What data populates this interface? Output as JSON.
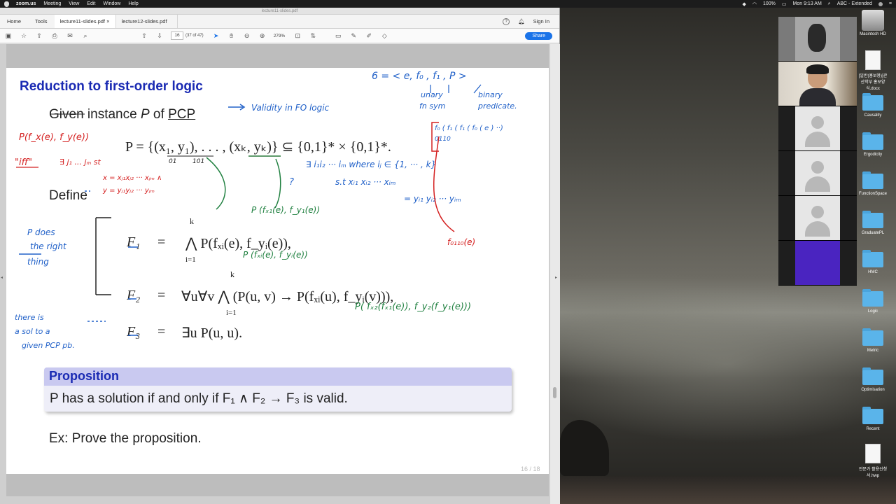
{
  "menubar": {
    "app": "zoom.us",
    "items": [
      "Meeting",
      "View",
      "Edit",
      "Window",
      "Help"
    ],
    "battery": "100%",
    "datetime": "Mon 9:13 AM",
    "input": "ABC - Extended"
  },
  "window": {
    "title": "lecture11-slides.pdf"
  },
  "tabs": {
    "home": "Home",
    "tools": "Tools",
    "tab1": "lecture11-slides.pdf",
    "tab2": "lecture12-slides.pdf",
    "close": "×",
    "help": "?",
    "signin": "Sign In"
  },
  "toolbar": {
    "page_current": "16",
    "page_of": "(37 of 47)",
    "zoom": "279%",
    "share": "Share"
  },
  "slide": {
    "title": "Reduction to first-order logic",
    "given_pre": "Given instance ",
    "given_P": "P",
    "given_mid": " of ",
    "given_pcp": "PCP",
    "p_def": "P = {(x₁, y₁), . . . , (xₖ, yₖ)} ⊆ {0,1}* × {0,1}*.",
    "define": "Define",
    "f1_lhs": "F₁",
    "f1_rhs": "⋀ P(fₓᵢ(e), f_yᵢ(e)),",
    "f2_lhs": "F₂",
    "f2_rhs": "∀u∀v ⋀ (P(u, v) → P(fₓᵢ(u), f_yᵢ(v))),",
    "f3_lhs": "F₃",
    "f3_rhs": "∃u P(u, u).",
    "eq": "=",
    "k": "k",
    "i_eq_1": "i=1",
    "prop_head": "Proposition",
    "prop_body": "P has a solution if and only if F₁ ∧ F₂ → F₃ is valid.",
    "ex": "Ex: Prove the proposition.",
    "pagenum": "16 / 18"
  },
  "annotations": {
    "b1": "6 = < e, f₀ , f₁ , P >",
    "b2": "unary",
    "b3": "binary",
    "b4": "fn sym",
    "b5": "predicate.",
    "b6": "Validity in FO logic",
    "b7": "f₀ ( f₁ ( f₁ ( f₀ ( e ) ··)",
    "b8": "0110",
    "b9": "∃ i₁i₂ ··· iₘ  where  iⱼ ∈ {1, ··· , k}",
    "b10": "s.t  xᵢ₁ xᵢ₂ ··· xᵢₘ",
    "b11": "= yᵢ₁ yᵢ₂ ··· yᵢₘ",
    "b12": "?",
    "b13": "P does",
    "b14": "the right",
    "b15": "thing",
    "b16": "there is",
    "b17": "a sol to a",
    "b18": "given PCP pb.",
    "r1": "P(f_x(e), f_y(e))",
    "r2": "\"iff\"",
    "r3": "∃ j₁ ... jₘ st",
    "r4": "x = xⱼ₁xⱼ₂ ··· xⱼₘ ∧",
    "r5": "y = yⱼ₁yⱼ₂ ··· yⱼₘ",
    "r6": "f₀₁₁₀(e)",
    "g1": "P (fₓ₁(e), f_y₁(e))",
    "g2": "P (fₓᵢ(e), f_yᵢ(e))",
    "g3": "P( fₓ₂(fₓ₁(e)), f_y₂(f_y₁(e)))",
    "k1": "01",
    "k2": "101"
  },
  "zoom": {
    "tiles": 6
  },
  "desktop_icons": [
    "Macintosh HD",
    "[일반(홍보용)]관산학부 홍보양식.docx",
    "Causality",
    "Ergodicity",
    "FunctionSpace",
    "GraduatePL",
    "HMC",
    "Logic",
    "Metric",
    "Optimisation",
    "Recent",
    "전문가 활용신청 서.hwp"
  ],
  "colors": {
    "title_blue": "#1a2ab3",
    "ink_blue": "#2060c8",
    "ink_red": "#d42020",
    "ink_green": "#208040",
    "share_blue": "#1a73e8",
    "zoom_purple": "#4a24c0"
  }
}
